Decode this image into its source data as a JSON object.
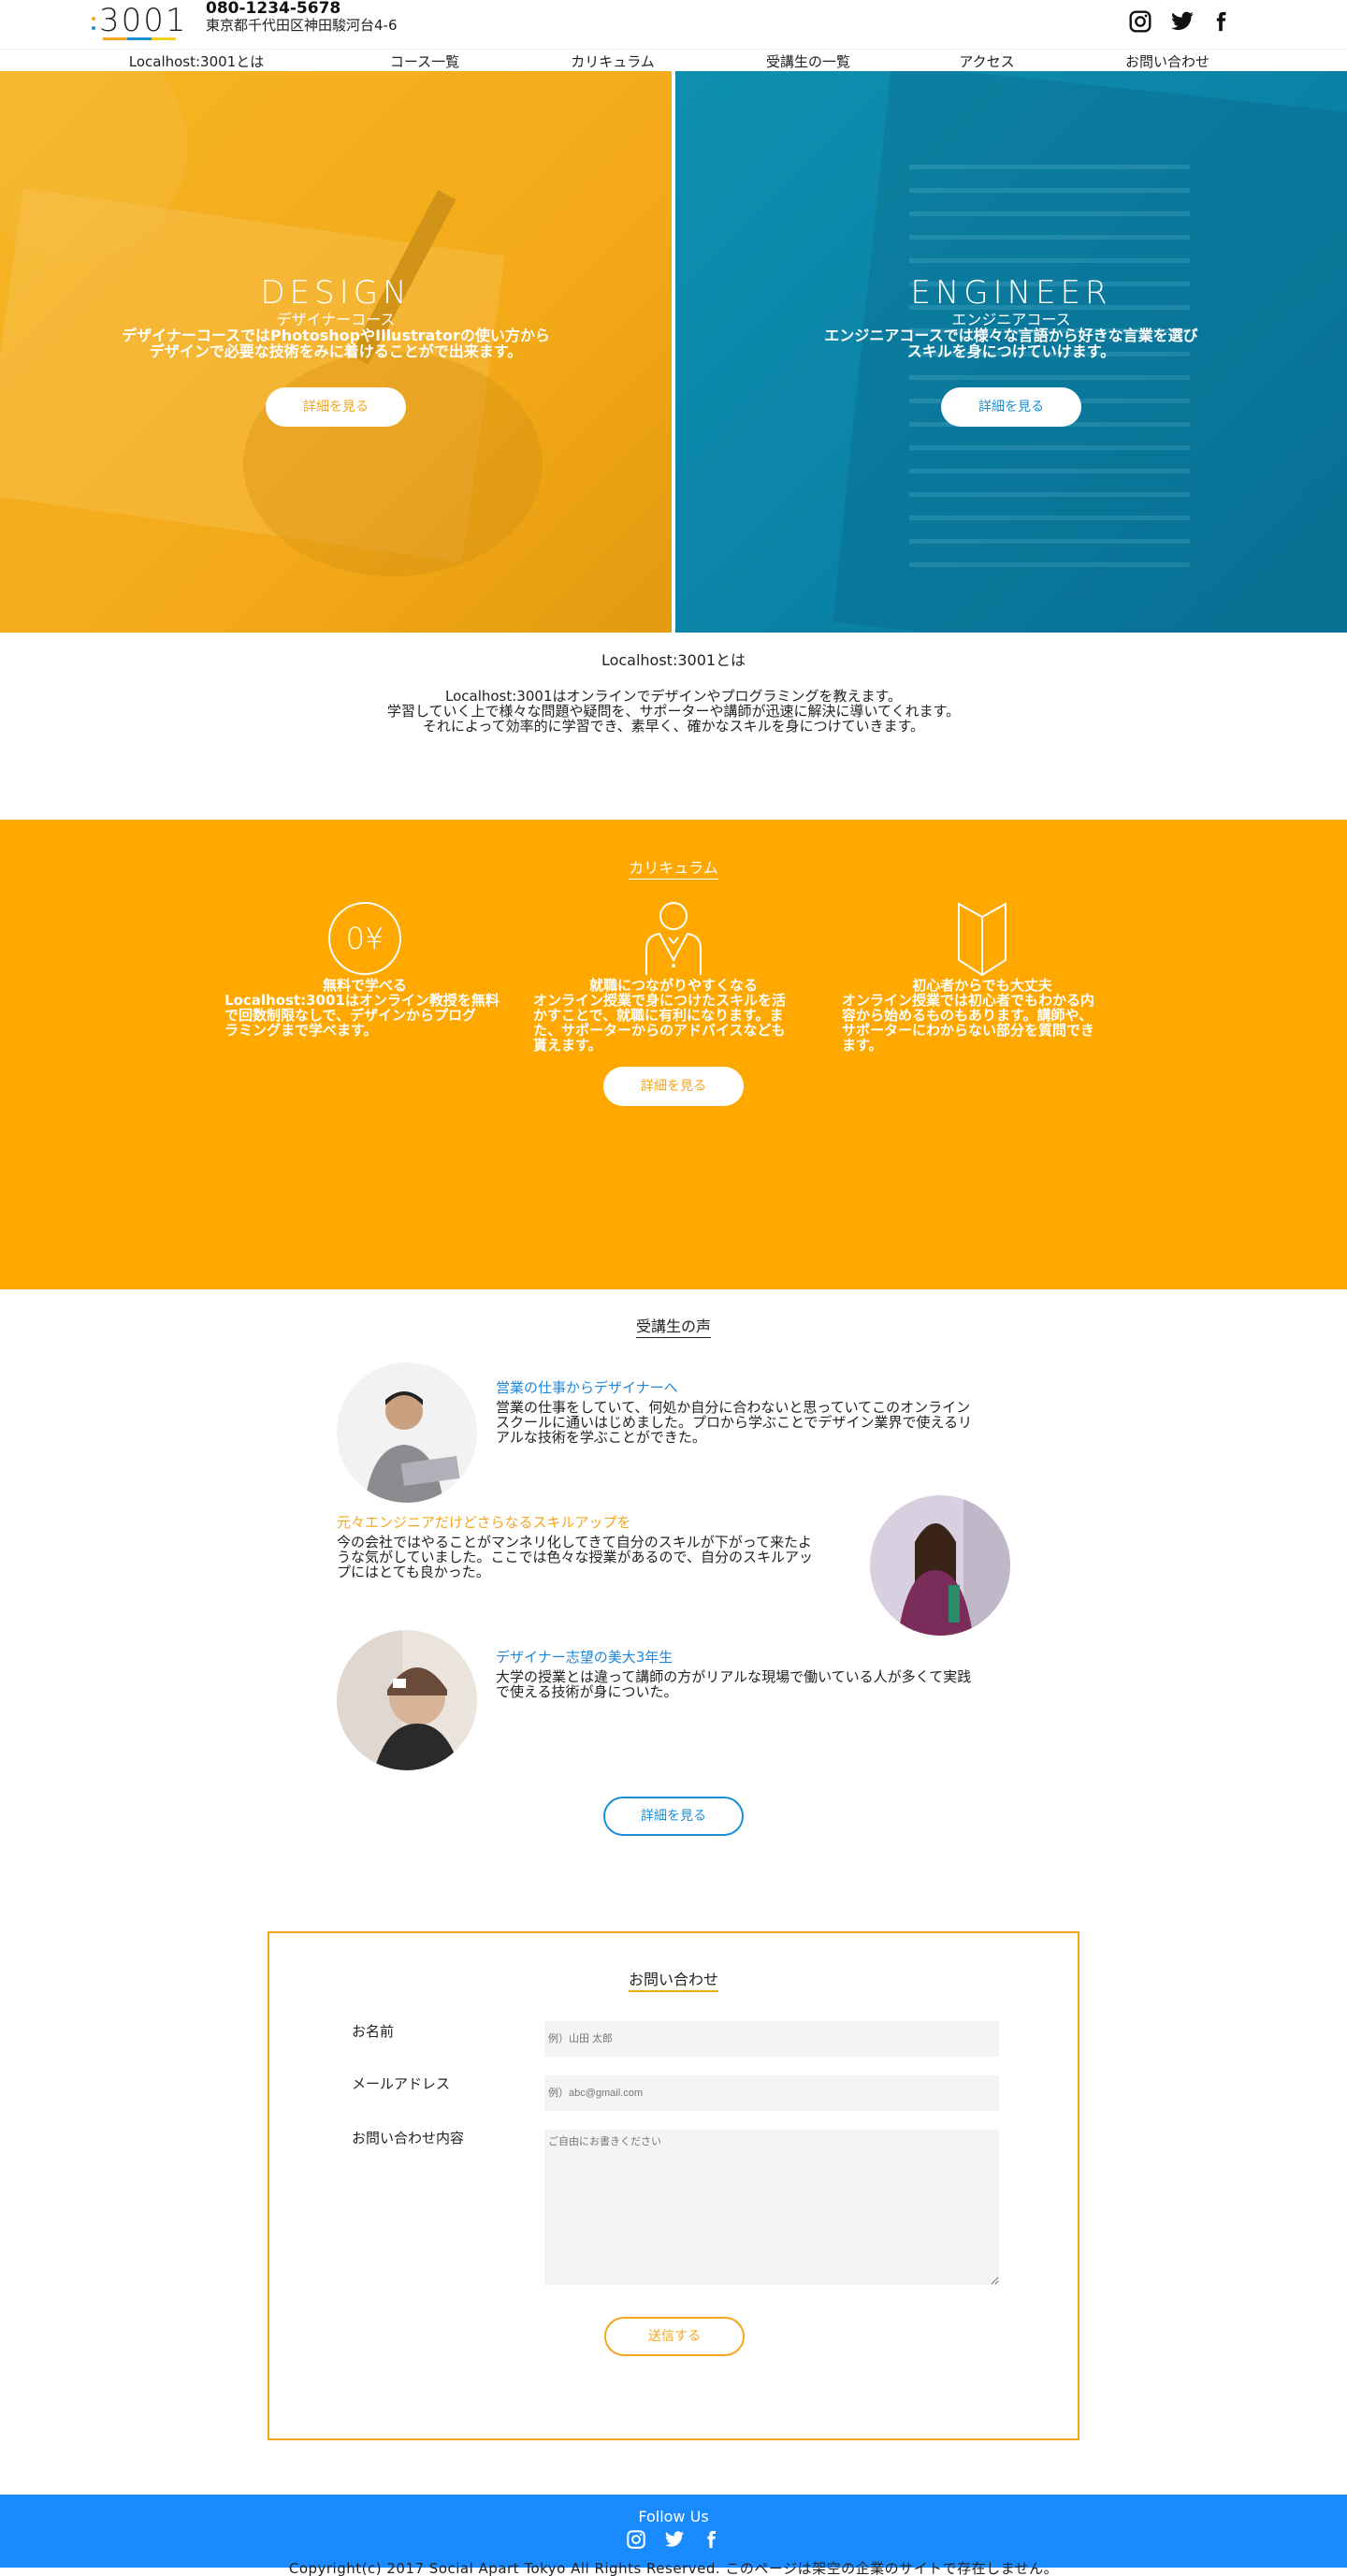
{
  "header": {
    "tel": "080-1234-5678",
    "address": "東京都千代田区神田駿河台4-6",
    "logo_text": "3001"
  },
  "nav": [
    {
      "label": "Localhost:3001とは"
    },
    {
      "label": "コース一覧"
    },
    {
      "label": "カリキュラム"
    },
    {
      "label": "受講生の一覧"
    },
    {
      "label": "アクセス"
    },
    {
      "label": "お問い合わせ"
    }
  ],
  "hero": {
    "design": {
      "title": "DESIGN",
      "subtitle": "デザイナーコース",
      "line1": "デザイナーコースではPhotoshopやIllustratorの使い方から",
      "line2": "デザインで必要な技術をみに着けることがで出来ます。",
      "button": "詳細を見る"
    },
    "engineer": {
      "title": "ENGINEER",
      "subtitle": "エンジニアコース",
      "line1": "エンジニアコースでは様々な言語から好きな言業を選び",
      "line2": "スキルを身につけていけます。",
      "button": "詳細を見る"
    }
  },
  "about": {
    "title": "Localhost:3001とは",
    "line1": "Localhost:3001はオンラインでデザインやプログラミングを教えます。",
    "line2": "学習していく上で様々な問題や疑問を、サポーターや講師が迅速に解決に導いてくれます。",
    "line3": "それによって効率的に学習でき、素早く、確かなスキルを身につけていきます。"
  },
  "curriculum": {
    "title": "カリキュラム",
    "items": [
      {
        "head": "無料で学べる",
        "lines": [
          "Localhost:3001はオンライン教授を無料",
          "で回数制限なしで、デザインからプログ",
          "ラミングまで学べます。"
        ]
      },
      {
        "head": "就職につながりやすくなる",
        "lines": [
          "オンライン授業で身につけたスキルを活",
          "かすことで、就職に有利になります。ま",
          "た、サポーターからのアドバイスなども",
          "貰えます。"
        ]
      },
      {
        "head": "初心者からでも大丈夫",
        "lines": [
          "オンライン授業では初心者でもわかる内",
          "容から始めるものもあります。講師や、",
          "サポーターにわからない部分を質問でき",
          "ます。"
        ]
      }
    ],
    "icon_yen_text": "0¥",
    "button": "詳細を見る"
  },
  "voices": {
    "title": "受講生の声",
    "items": [
      {
        "title": "営業の仕事からデザイナーへ",
        "lines": [
          "営業の仕事をしていて、何処か自分に合わないと思っていてこのオンライン",
          "スクールに通いはじめました。プロから学ぶことでデザイン業界で使えるリ",
          "アルな技術を学ぶことができた。"
        ]
      },
      {
        "title": "元々エンジニアだけどさらなるスキルアップを",
        "lines": [
          "今の会社ではやることがマンネリ化してきて自分のスキルが下がって来たよ",
          "うな気がしていました。ここでは色々な授業があるので、自分のスキルアッ",
          "プにはとても良かった。"
        ]
      },
      {
        "title": "デザイナー志望の美大3年生",
        "lines": [
          "大学の授業とは違って講師の方がリアルな現場で働いている人が多くて実践",
          "で使える技術が身についた。"
        ]
      }
    ],
    "button": "詳細を見る"
  },
  "contact": {
    "title": "お問い合わせ",
    "name_label": "お名前",
    "name_placeholder": "例）山田 太郎",
    "email_label": "メールアドレス",
    "email_placeholder": "例）abc@gmail.com",
    "message_label": "お問い合わせ内容",
    "message_placeholder": "ご自由にお書きください",
    "submit": "送信する"
  },
  "footer": {
    "follow": "Follow Us",
    "copyright": "Copyright(c) 2017 Social Apart Tokyo All Rights Reserved. このページは架空の企業のサイトで存在しません。"
  },
  "icons": {
    "instagram": "instagram-icon",
    "twitter": "twitter-icon",
    "facebook": "facebook-icon"
  },
  "colors": {
    "orange": "#ffa800",
    "blue": "#1a8bff",
    "design_bg": "#f4aa18",
    "engineer_bg": "#0a82a7"
  }
}
